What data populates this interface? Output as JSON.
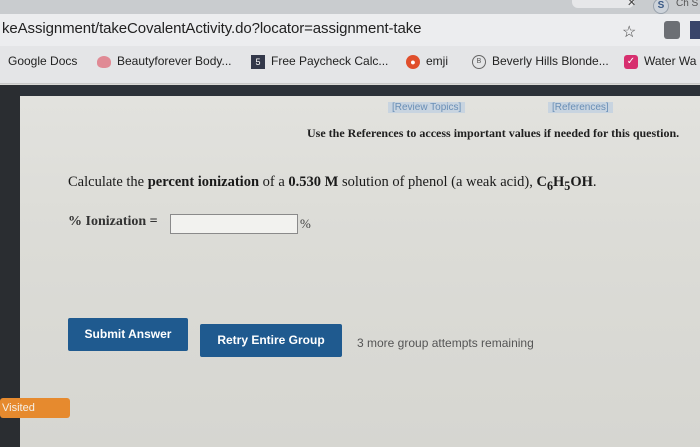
{
  "browser": {
    "tab_right_label": "Ch S",
    "ext_letter": "S",
    "url": "keAssignment/takeCovalentActivity.do?locator=assignment-take",
    "bookmarks": [
      {
        "label": "Google Docs",
        "icon": "none"
      },
      {
        "label": "Beautyforever Body...",
        "icon": "rose-icon"
      },
      {
        "label": "Free Paycheck Calc...",
        "icon": "five-icon"
      },
      {
        "label": "emji",
        "icon": "emji-icon"
      },
      {
        "label": "Beverly Hills Blonde...",
        "icon": "bh-icon"
      },
      {
        "label": "Water Wa",
        "icon": "check-icon"
      }
    ],
    "five_icon_text": "5",
    "bh_icon_text": "B"
  },
  "page": {
    "review_topics": "[Review Topics]",
    "references": "[References]",
    "note": "Use the References to access important values if needed for this question.",
    "question_prefix": "Calculate the ",
    "question_bold": "percent ionization",
    "question_mid": " of a ",
    "question_conc": "0.530 M",
    "question_suffix": " solution of phenol (a weak acid), ",
    "formula": {
      "c": "C",
      "c_sub": "6",
      "h": "H",
      "h_sub": "5",
      "oh": "OH",
      "end": "."
    },
    "ionization_label": "% Ionization =",
    "ionization_value": "",
    "ionization_unit": "%",
    "submit_label": "Submit Answer",
    "retry_label": "Retry Entire Group",
    "attempts_text": "3 more group attempts remaining",
    "visited_label": "Visited"
  },
  "colors": {
    "button": "#1f5a8f",
    "visited": "#e68a2e",
    "link": "#6a8fb6"
  }
}
